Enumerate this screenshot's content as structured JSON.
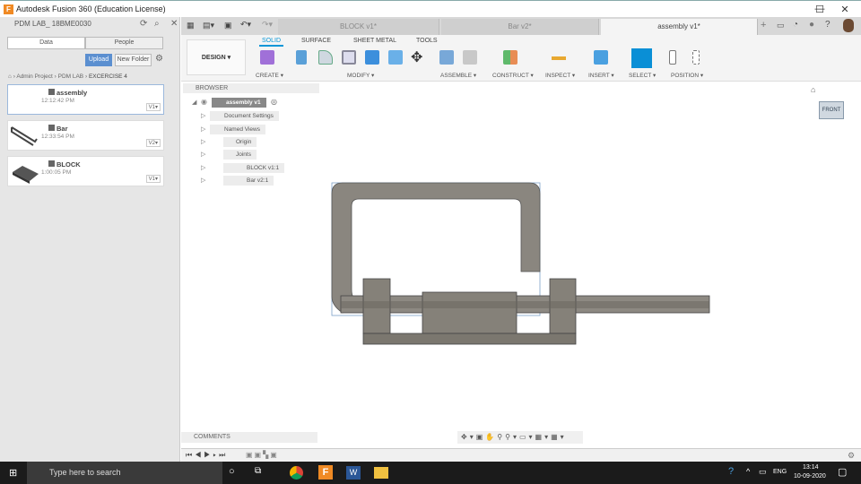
{
  "window": {
    "title": "Autodesk Fusion 360 (Education License)",
    "minimize": "—",
    "maximize": "☐",
    "close": "✕"
  },
  "data_panel": {
    "project": "PDM LAB_ 18BME0030",
    "tabs": [
      "Data",
      "People"
    ],
    "upload": "Upload",
    "new_folder": "New Folder",
    "breadcrumb": [
      "Admin Project",
      "PDM LAB",
      "EXCERCISE 4"
    ],
    "files": [
      {
        "name": "assembly",
        "time": "12:12:42 PM",
        "version": "V1▾"
      },
      {
        "name": "Bar",
        "time": "12:33:54 PM",
        "version": "V2▾"
      },
      {
        "name": "BLOCK",
        "time": "1:00:05 PM",
        "version": "V1▾"
      }
    ]
  },
  "doc_tabs": [
    {
      "label": "BLOCK v1*"
    },
    {
      "label": "Bar v2*"
    },
    {
      "label": "assembly v1*"
    }
  ],
  "ribbon": {
    "workspace": "DESIGN ▾",
    "tabs": [
      "SOLID",
      "SURFACE",
      "SHEET METAL",
      "TOOLS"
    ],
    "groups": [
      "CREATE ▾",
      "MODIFY ▾",
      "ASSEMBLE ▾",
      "CONSTRUCT ▾",
      "INSPECT ▾",
      "INSERT ▾",
      "SELECT ▾",
      "POSITION ▾"
    ]
  },
  "browser": {
    "title": "BROWSER",
    "root": "assembly v1",
    "nodes": [
      "Document Settings",
      "Named Views",
      "Origin",
      "Joints",
      "BLOCK v1:1",
      "Bar v2:1"
    ]
  },
  "viewcube": {
    "face": "FRONT"
  },
  "comments": "COMMENTS",
  "taskbar": {
    "search": "Type here to search",
    "lang": "ENG",
    "time": "13:14",
    "date": "10-09-2020"
  },
  "colors": {
    "accent": "#0696d7",
    "select": "#0a8fd6"
  }
}
